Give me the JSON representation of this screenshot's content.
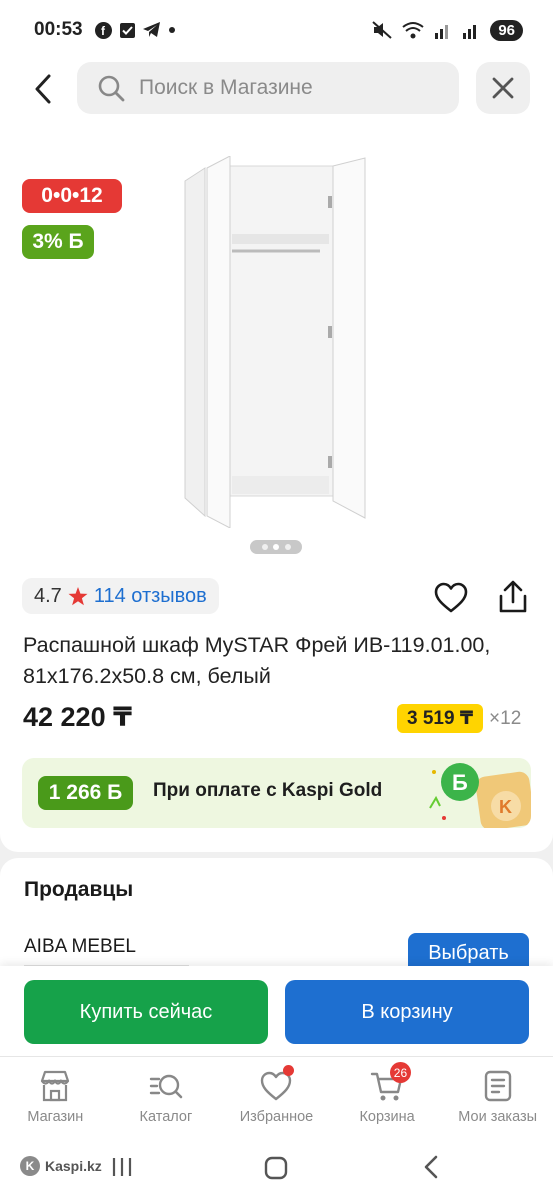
{
  "status": {
    "time": "00:53",
    "battery": "96"
  },
  "search": {
    "placeholder": "Поиск в Магазине"
  },
  "product": {
    "countdown_badge": "0•0•12",
    "bonus_badge": "3% Б",
    "rating": "4.7",
    "reviews": "114 отзывов",
    "title": "Распашной шкаф MySTAR Фрей ИВ-119.01.00, 81x176.2x50.8 см, белый",
    "price": "42 220 ₸",
    "installment_amount": "3 519 ₸",
    "installment_months": "×12",
    "image_slide_count": 3,
    "current_slide": 2
  },
  "kaspi_gold": {
    "bonus": "1 266 Б",
    "text": "При оплате с Kaspi Gold"
  },
  "sellers": {
    "title": "Продавцы",
    "seller_name": "AIBA MEBEL",
    "choose_label": "Выбрать"
  },
  "actions": {
    "buy_now": "Купить сейчас",
    "add_to_cart": "В корзину"
  },
  "bottom_nav": {
    "items": [
      {
        "label": "Магазин",
        "icon": "shop-icon"
      },
      {
        "label": "Каталог",
        "icon": "catalog-search-icon"
      },
      {
        "label": "Избранное",
        "icon": "heart-icon",
        "has_dot": true
      },
      {
        "label": "Корзина",
        "icon": "cart-icon",
        "count": "26"
      },
      {
        "label": "Мои заказы",
        "icon": "orders-icon"
      }
    ]
  },
  "system": {
    "watermark": "Kaspi.kz"
  },
  "colors": {
    "brand_red": "#e53935",
    "bonus_green": "#5aa41c",
    "buy_green": "#16a24a",
    "link_blue": "#1e6fd0",
    "installment_yellow": "#ffd400"
  }
}
